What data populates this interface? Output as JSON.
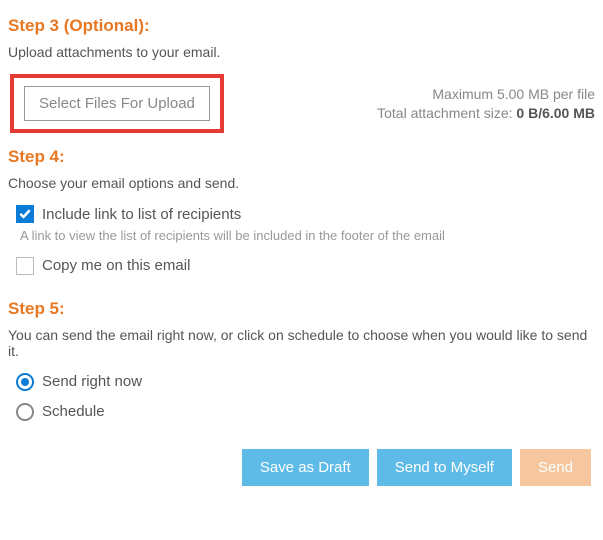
{
  "step3": {
    "heading": "Step 3 (Optional):",
    "desc": "Upload attachments to your email.",
    "select_files_label": "Select Files For Upload",
    "max_per_file": "Maximum 5.00 MB per file",
    "total_prefix": "Total attachment size: ",
    "total_value": "0 B/6.00 MB"
  },
  "step4": {
    "heading": "Step 4:",
    "desc": "Choose your email options and send.",
    "include_link": {
      "label": "Include link to list of recipients",
      "checked": true,
      "hint": "A link to view the list of recipients will be included in the footer of the email"
    },
    "copy_me": {
      "label": "Copy me on this email",
      "checked": false
    }
  },
  "step5": {
    "heading": "Step 5:",
    "desc": "You can send the email right now, or click on schedule to choose when you would like to send it.",
    "send_now": {
      "label": "Send right now",
      "selected": true
    },
    "schedule": {
      "label": "Schedule",
      "selected": false
    }
  },
  "actions": {
    "save_draft": "Save as Draft",
    "send_myself": "Send to Myself",
    "send": "Send"
  }
}
